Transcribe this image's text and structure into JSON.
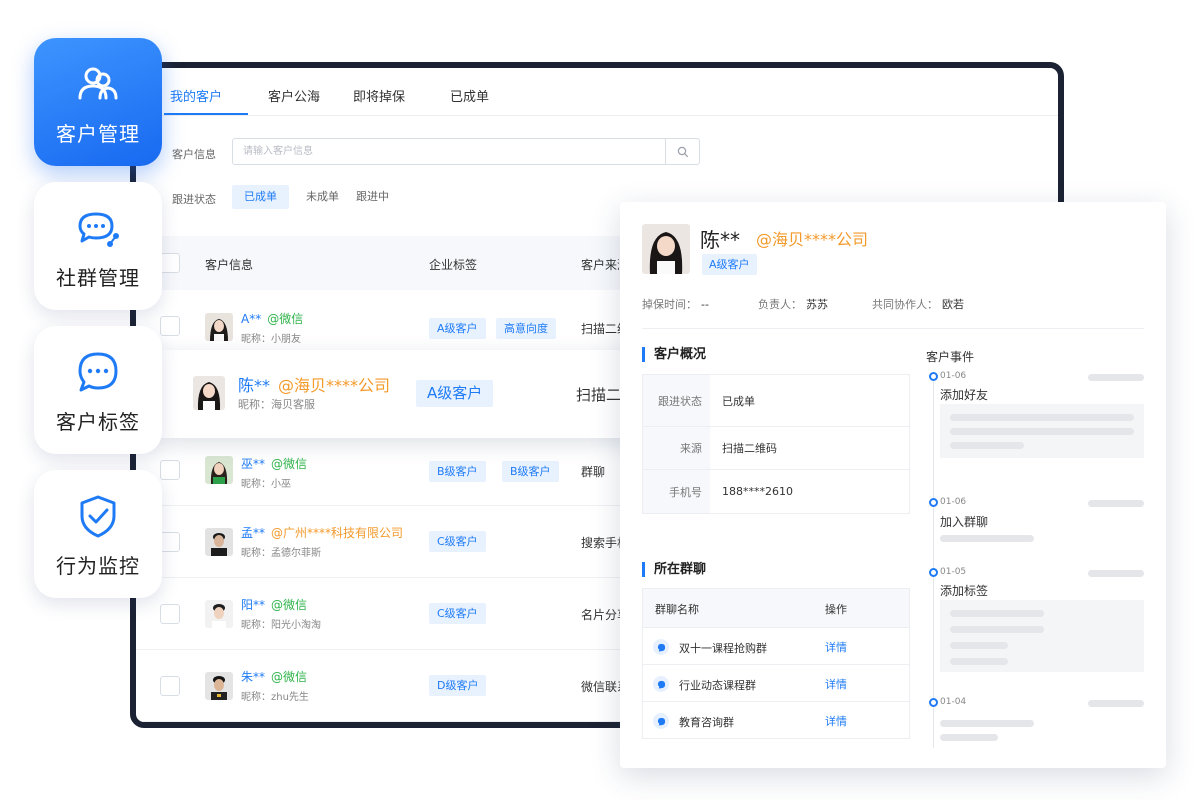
{
  "sidebar": {
    "cards": [
      {
        "label": "客户管理",
        "icon": "users-icon",
        "active": true
      },
      {
        "label": "社群管理",
        "icon": "chat-share-icon",
        "active": false
      },
      {
        "label": "客户标签",
        "icon": "message-tag-icon",
        "active": false
      },
      {
        "label": "行为监控",
        "icon": "shield-check-icon",
        "active": false
      }
    ]
  },
  "main": {
    "tabs": [
      {
        "label": "我的客户",
        "active": true
      },
      {
        "label": "客户公海"
      },
      {
        "label": "即将掉保"
      },
      {
        "label": "已成单"
      }
    ],
    "filters": {
      "customer_info_label": "客户信息",
      "search_placeholder": "请输入客户信息",
      "status_label": "跟进状态",
      "status_options": [
        "已成单",
        "未成单",
        "跟进中"
      ],
      "status_selected": "已成单"
    },
    "table": {
      "columns": [
        "客户信息",
        "企业标签",
        "客户来源"
      ],
      "rows": [
        {
          "name": "A**",
          "source_tag": "@微信",
          "source_type": "wechat",
          "nickname": "昵称：小朋友",
          "tags": [
            "A级客户",
            "高意向度"
          ],
          "source": "扫描二维码"
        },
        {
          "name": "巫**",
          "source_tag": "@微信",
          "source_type": "wechat",
          "nickname": "昵称：小巫",
          "tags": [
            "B级客户",
            "B级客户"
          ],
          "source": "群聊"
        },
        {
          "name": "孟**",
          "source_tag": "@广州****科技有限公司",
          "source_type": "company",
          "nickname": "昵称：孟德尔菲斯",
          "tags": [
            "C级客户"
          ],
          "source": "搜索手机号"
        },
        {
          "name": "阳**",
          "source_tag": "@微信",
          "source_type": "wechat",
          "nickname": "昵称：阳光小淘淘",
          "tags": [
            "C级客户"
          ],
          "source": "名片分享"
        },
        {
          "name": "朱**",
          "source_tag": "@微信",
          "source_type": "wechat",
          "nickname": "昵称：zhu先生",
          "tags": [
            "D级客户"
          ],
          "source": "微信联系人"
        }
      ],
      "highlight_row": {
        "name": "陈**",
        "source_tag": "@海贝****公司",
        "nickname": "昵称：海贝客服",
        "tag": "A级客户",
        "source": "扫描二维码"
      }
    }
  },
  "detail": {
    "name": "陈**",
    "company": "@海贝****公司",
    "level_tag": "A级客户",
    "meta": [
      {
        "key": "掉保时间：",
        "value": "--"
      },
      {
        "key": "负责人：",
        "value": "苏苏"
      },
      {
        "key": "共同协作人：",
        "value": "欧若"
      }
    ],
    "overview_title": "客户概况",
    "overview": [
      {
        "key": "跟进状态",
        "value": "已成单"
      },
      {
        "key": "来源",
        "value": "扫描二维码"
      },
      {
        "key": "手机号",
        "value": "188****2610"
      }
    ],
    "groups_title": "所在群聊",
    "groups_columns": [
      "群聊名称",
      "操作"
    ],
    "groups": [
      {
        "name": "双十一课程抢购群",
        "action": "详情"
      },
      {
        "name": "行业动态课程群",
        "action": "详情"
      },
      {
        "name": "教育咨询群",
        "action": "详情"
      }
    ],
    "events_title": "客户事件",
    "events": [
      {
        "date": "01-06",
        "title": "添加好友"
      },
      {
        "date": "01-06",
        "title": "加入群聊"
      },
      {
        "date": "01-05",
        "title": "添加标签"
      },
      {
        "date": "01-04",
        "title": ""
      }
    ]
  },
  "colors": {
    "accent": "#1f7bf5",
    "wechat": "#2fb34a",
    "company": "#f39a2b",
    "frame": "#1b2233"
  }
}
